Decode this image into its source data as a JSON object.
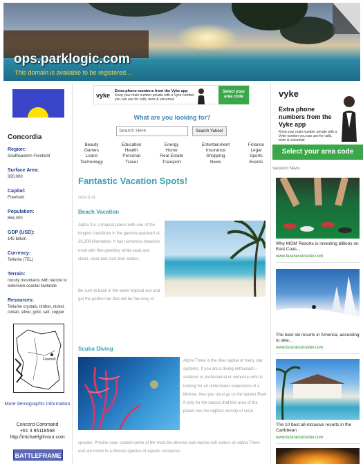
{
  "header": {
    "title": "ops.parklogic.com",
    "subtitle": "This domain is available to be registered..."
  },
  "sidebar": {
    "country": "Concordia",
    "facts": [
      {
        "key": "Region:",
        "value": "Southeastern Freehold"
      },
      {
        "key": "Surface Area:",
        "value": "300,000"
      },
      {
        "key": "Capital:",
        "value": "Freehold"
      },
      {
        "key": "Population:",
        "value": "654,000"
      },
      {
        "key": "GDP (USD):",
        "value": "145 billion"
      },
      {
        "key": "Currency:",
        "value": "Tellurite (TEL)"
      },
      {
        "key": "Terrain:",
        "value": "mostly mountains with narrow to extensive coastal lowlands"
      },
      {
        "key": "Resources:",
        "value": "Tellurite crystals, timber, nickel, cobalt, silver, gold, salt, copper"
      }
    ],
    "map_label": "Freeholt",
    "more_demo": "More demographic information",
    "contact_name": "Concord Command",
    "contact_phone": "+61 3 95118568",
    "contact_url": "http://michaelgilmour.com",
    "battleframe": "BATTLEFRAME"
  },
  "ad_top": {
    "logo": "vyke",
    "headline": "Extra phone numbers from the Vyke app",
    "text": "Keep your main number private with a Vyke number you can use for calls, texts & voicemail",
    "cta": "Select your area code"
  },
  "search": {
    "heading": "What are you looking for?",
    "placeholder": "Search Here",
    "button": "Search Yahoo!"
  },
  "categories": [
    [
      "Beauty",
      "Games",
      "Loans",
      "Technology"
    ],
    [
      "Education",
      "Health",
      "Personal",
      "Travel"
    ],
    [
      "Energy",
      "Home",
      "Real Estate",
      "Transport"
    ],
    [
      "Entertainment",
      "Insurance",
      "Shopping",
      "News"
    ],
    [
      "Finance",
      "Legal",
      "Sports",
      "Events"
    ]
  ],
  "article": {
    "title": "Fantastic Vacation Spots!",
    "date": "2016-11-25",
    "beach_heading": "Beach Vacation",
    "beach_para1": "Alpha 3 is a tropical planet with one of the longest coastlines in the gamma quadrant at 36,209 kilometres. It has numerous beaches most with fine powdery white sand and clean, clear and cool blue waters.",
    "beach_para2": "Be sure to bask in the warm tropical sun and get the perfect tan that will be the envy of your friends back home. Top beach locations: Research Ravine, Concord Central, Thunder Beach, Starside Lagoon and the not to be missed Moonshadow Landing.",
    "scuba_heading": "Scuba Diving",
    "scuba_para1": "Alpha Three is the dive capital of many star systems. If you are a diving enthusiast— amateur or professional or someone who is looking for an underwater experience of a lifetime, then you must go to the Vander Reef. If only for the reason that this area of the planet has the highest density of coral",
    "scuba_para2": "species. Pristine seas contain some of the most bio-diverse and marine-rich waters on Alpha Three and are home to a diverse species of aquatic resources."
  },
  "ad_right": {
    "logo": "vyke",
    "headline": "Extra phone numbers from the Vyke app",
    "text": "Keep your main number private with a Vyke number you can use for calls, texts & voicemail",
    "cta": "Select your area code"
  },
  "news": {
    "heading": "Vacation News",
    "items": [
      {
        "caption": "Why MGM Resorts is investing billions on East Coas...",
        "source": "www.businessinsider.com"
      },
      {
        "caption": "The best ski resorts in America, according to skie...",
        "source": "www.businessinsider.com"
      },
      {
        "caption": "The 10 best all-inclusive resorts in the Caribbean",
        "source": "www.businessinsider.com"
      }
    ]
  },
  "colors": {
    "accent_teal": "#3aa0b0",
    "link_blue": "#2a3fb0",
    "cta_green": "#3aa84a",
    "subtitle_yellow": "#f6d54a"
  }
}
